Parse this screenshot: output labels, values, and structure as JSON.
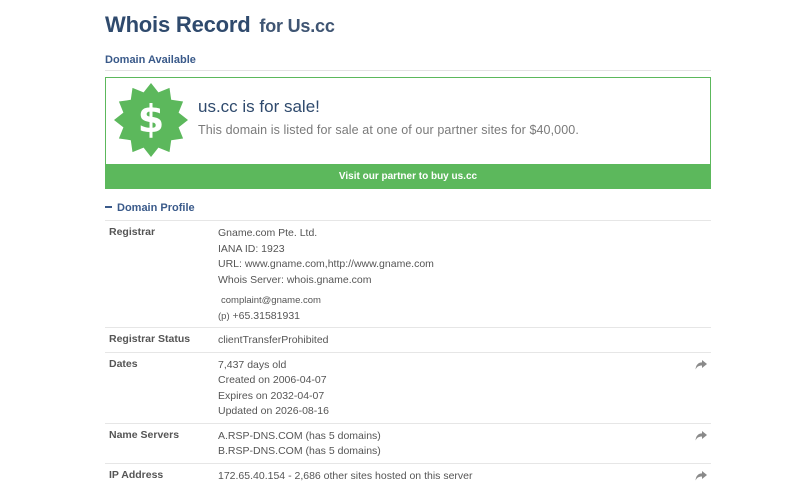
{
  "header": {
    "title": "Whois Record",
    "subtitle": "for Us.cc"
  },
  "availability": {
    "label": "Domain Available"
  },
  "sale": {
    "title": "us.cc is for sale!",
    "description": "This domain is listed for sale at one of our partner sites for $40,000.",
    "cta": "Visit our partner to buy us.cc",
    "icon": "dollar-badge-icon",
    "accent_color": "#5cb85c"
  },
  "profile": {
    "heading": "Domain Profile",
    "rows": {
      "registrar": {
        "label": "Registrar",
        "name": "Gname.com Pte. Ltd.",
        "iana": "IANA ID: 1923",
        "url": "URL: www.gname.com,http://www.gname.com",
        "whois_server": "Whois Server: whois.gname.com",
        "email": "complaint@gname.com",
        "phone_prefix": "(p)",
        "phone": "+65.31581931"
      },
      "status": {
        "label": "Registrar Status",
        "value": "clientTransferProhibited"
      },
      "dates": {
        "label": "Dates",
        "age": "7,437 days old",
        "created": "Created on 2006-04-07",
        "expires": "Expires on 2032-04-07",
        "updated": "Updated on 2026-08-16"
      },
      "nameservers": {
        "label": "Name Servers",
        "ns1": "A.RSP-DNS.COM (has 5 domains)",
        "ns2": "B.RSP-DNS.COM (has 5 domains)"
      },
      "ip": {
        "label": "IP Address",
        "value": "172.65.40.154 - 2,686 other sites hosted on this server"
      }
    }
  }
}
